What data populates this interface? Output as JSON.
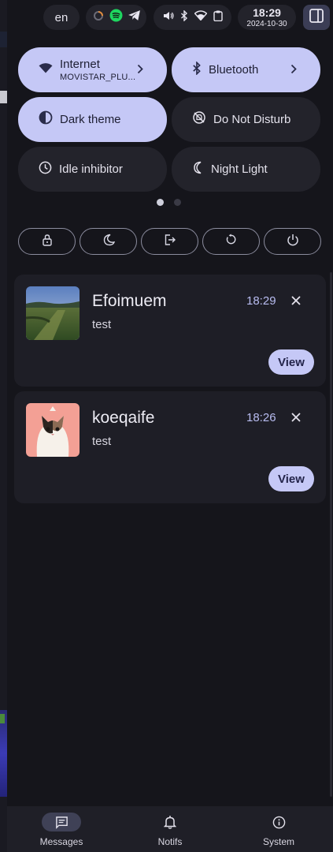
{
  "topbar": {
    "language": "en",
    "tray_icons": [
      "loader-icon",
      "spotify-icon",
      "telegram-icon"
    ],
    "system_icons": [
      "volume-icon",
      "bluetooth-icon",
      "wifi-icon",
      "clipboard-icon"
    ],
    "clock_time": "18:29",
    "clock_date": "2024-10-30",
    "sidebar_toggle_icon": "sidebar-icon"
  },
  "tiles": [
    {
      "label": "Internet",
      "sub": "MOVISTAR_PLU...",
      "icon": "wifi-icon",
      "state": "on",
      "has_chevron": true
    },
    {
      "label": "Bluetooth",
      "icon": "bluetooth-icon",
      "state": "on",
      "has_chevron": true
    },
    {
      "label": "Dark theme",
      "icon": "contrast-icon",
      "state": "on"
    },
    {
      "label": "Do Not Disturb",
      "icon": "bell-off-icon",
      "state": "off"
    },
    {
      "label": "Idle inhibitor",
      "icon": "clock-icon",
      "state": "off"
    },
    {
      "label": "Night Light",
      "icon": "moon-icon",
      "state": "off"
    }
  ],
  "pages": {
    "count": 2,
    "current": 1
  },
  "power_buttons": [
    "lock-icon",
    "sleep-icon",
    "logout-icon",
    "restart-icon",
    "power-icon"
  ],
  "notifications": [
    {
      "title": "Efoimuem",
      "body": "test",
      "time": "18:29",
      "action": "View",
      "thumb": "landscape"
    },
    {
      "title": "koeqaife",
      "body": "test",
      "time": "18:26",
      "action": "View",
      "thumb": "cat-avatar"
    }
  ],
  "nav": [
    {
      "label": "Messages",
      "icon": "message-icon",
      "active": true
    },
    {
      "label": "Notifs",
      "icon": "bell-icon",
      "active": false
    },
    {
      "label": "System",
      "icon": "info-icon",
      "active": false
    }
  ],
  "colors": {
    "accent": "#c5c8f6",
    "surface": "#23232b",
    "background": "#15151b"
  }
}
